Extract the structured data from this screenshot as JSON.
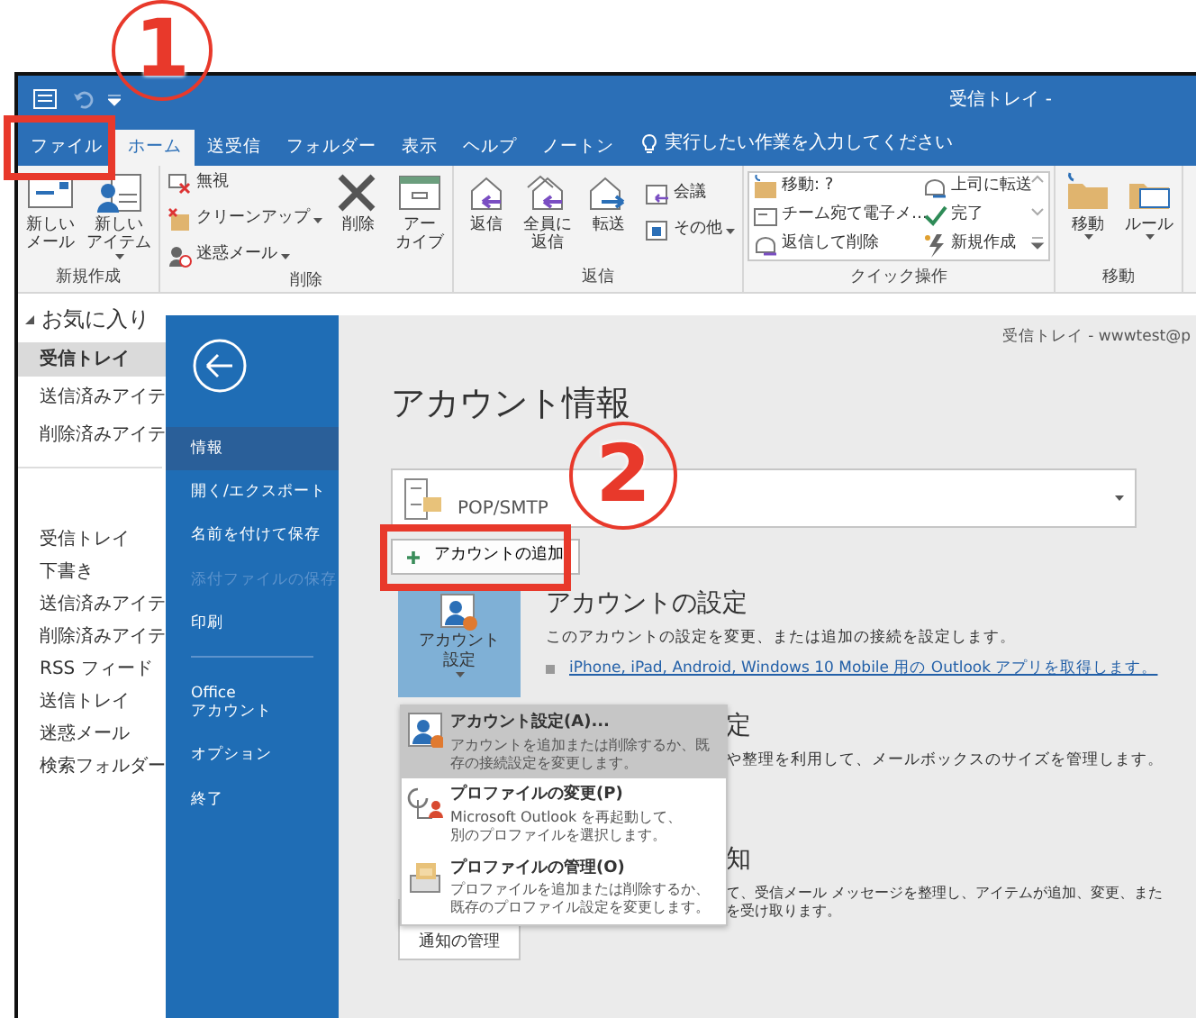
{
  "annotations": [
    {
      "number": "1"
    },
    {
      "number": "2"
    }
  ],
  "title_bar": {
    "title": "受信トレイ -"
  },
  "ribbon": {
    "tabs": [
      {
        "label": "ファイル",
        "selected": false
      },
      {
        "label": "ホーム",
        "selected": true
      },
      {
        "label": "送受信",
        "selected": false
      },
      {
        "label": "フォルダー",
        "selected": false
      },
      {
        "label": "表示",
        "selected": false
      },
      {
        "label": "ヘルプ",
        "selected": false
      },
      {
        "label": "ノートン",
        "selected": false
      }
    ],
    "tell_me": "実行したい作業を入力してください",
    "groups": [
      {
        "label": "新規作成",
        "buttons": [
          {
            "kind": "large",
            "lines": [
              "新しい",
              "メール"
            ],
            "dropdown": false
          },
          {
            "kind": "large",
            "lines": [
              "新しい",
              "アイテム"
            ],
            "dropdown": true
          }
        ]
      },
      {
        "label": "削除",
        "buttons": [
          {
            "kind": "small",
            "lines": [
              "無視"
            ],
            "dropdown": false
          },
          {
            "kind": "small",
            "lines": [
              "クリーンアップ"
            ],
            "dropdown": true
          },
          {
            "kind": "small",
            "lines": [
              "迷惑メール"
            ],
            "dropdown": true
          },
          {
            "kind": "large",
            "lines": [
              "削除"
            ],
            "dropdown": false
          },
          {
            "kind": "large",
            "lines": [
              "アー",
              "カイブ"
            ],
            "dropdown": false
          }
        ]
      },
      {
        "label": "返信",
        "buttons": [
          {
            "kind": "large",
            "lines": [
              "返信"
            ],
            "dropdown": false
          },
          {
            "kind": "large",
            "lines": [
              "全員に",
              "返信"
            ],
            "dropdown": false
          },
          {
            "kind": "large",
            "lines": [
              "転送"
            ],
            "dropdown": false
          },
          {
            "kind": "small",
            "lines": [
              "会議"
            ],
            "dropdown": false
          },
          {
            "kind": "small",
            "lines": [
              "その他"
            ],
            "dropdown": true
          }
        ]
      },
      {
        "label": "クイック操作",
        "buttons": [
          {
            "kind": "quick",
            "lines": [
              "移動: ?"
            ],
            "dropdown": false
          },
          {
            "kind": "quick",
            "lines": [
              "チーム宛て電子メ…"
            ],
            "dropdown": false
          },
          {
            "kind": "quick",
            "lines": [
              "返信して削除"
            ],
            "dropdown": false
          },
          {
            "kind": "quick",
            "lines": [
              "上司に転送"
            ],
            "dropdown": false
          },
          {
            "kind": "quick",
            "lines": [
              "完了"
            ],
            "dropdown": false
          },
          {
            "kind": "quick",
            "lines": [
              "新規作成"
            ],
            "dropdown": false
          }
        ]
      },
      {
        "label": "移動",
        "buttons": [
          {
            "kind": "large",
            "lines": [
              "移動"
            ],
            "dropdown": true
          },
          {
            "kind": "large",
            "lines": [
              "ルール"
            ],
            "dropdown": true
          }
        ]
      }
    ]
  },
  "folder_pane": {
    "favorites_header": "お気に入り",
    "favorites": [
      {
        "label": "受信トレイ",
        "selected": true
      },
      {
        "label": "送信済みアイテ",
        "selected": false
      },
      {
        "label": "削除済みアイテ",
        "selected": false
      }
    ],
    "folders": [
      {
        "label": "受信トレイ"
      },
      {
        "label": "下書き"
      },
      {
        "label": "送信済みアイテ"
      },
      {
        "label": "削除済みアイテ"
      },
      {
        "label": "RSS フィード"
      },
      {
        "label": "送信トレイ"
      },
      {
        "label": "迷惑メール"
      },
      {
        "label": "検索フォルダー"
      }
    ]
  },
  "backstage": {
    "nav": [
      {
        "kind": "item",
        "lines": [
          "情報"
        ],
        "selected": true,
        "disabled": false
      },
      {
        "kind": "item",
        "lines": [
          "開く/エクスポート"
        ],
        "selected": false,
        "disabled": false
      },
      {
        "kind": "item",
        "lines": [
          "名前を付けて保存"
        ],
        "selected": false,
        "disabled": false
      },
      {
        "kind": "item",
        "lines": [
          "添付ファイルの保存"
        ],
        "selected": false,
        "disabled": true
      },
      {
        "kind": "item",
        "lines": [
          "印刷"
        ],
        "selected": false,
        "disabled": false
      },
      {
        "kind": "divider"
      },
      {
        "kind": "item",
        "lines": [
          "Office",
          "アカウント"
        ],
        "selected": false,
        "disabled": false
      },
      {
        "kind": "item",
        "lines": [
          "オプション"
        ],
        "selected": false,
        "disabled": false
      },
      {
        "kind": "item",
        "lines": [
          "終了"
        ],
        "selected": false,
        "disabled": false
      }
    ],
    "header": "受信トレイ - wwwtest@p",
    "title": "アカウント情報",
    "account_selector": {
      "value": "POP/SMTP"
    },
    "add_account_button": "アカウントの追加",
    "sections": [
      {
        "tile_lines": [
          "アカウント",
          "設定"
        ],
        "tile_dropdown": true,
        "heading": "アカウントの設定",
        "description_lines": [
          "このアカウントの設定を変更、または追加の接続を設定します。"
        ],
        "link": "iPhone, iPad, Android, Windows 10 Mobile 用の Outlook アプリを取得します。"
      },
      {
        "heading": "定",
        "description_lines": [
          "や整理を利用して、メールボックスのサイズを管理します。"
        ]
      },
      {
        "tile_lines": [
          "通知の管理"
        ],
        "tile_dropdown": false,
        "heading": "知",
        "description_lines": [
          "て、受信メール メッセージを整理し、アイテムが追加、変更、また",
          "を受け取ります。"
        ]
      }
    ],
    "menu": [
      {
        "title": "アカウント設定(A)...",
        "description_lines": [
          "アカウントを追加または削除するか、既",
          "存の接続設定を変更します。"
        ],
        "selected": true
      },
      {
        "title": "プロファイルの変更(P)",
        "description_lines": [
          "Microsoft Outlook を再起動して、",
          "別のプロファイルを選択します。"
        ],
        "selected": false
      },
      {
        "title": "プロファイルの管理(O)",
        "description_lines": [
          "プロファイルを追加または削除するか、",
          "既存のプロファイル設定を変更します。"
        ],
        "selected": false
      }
    ]
  }
}
